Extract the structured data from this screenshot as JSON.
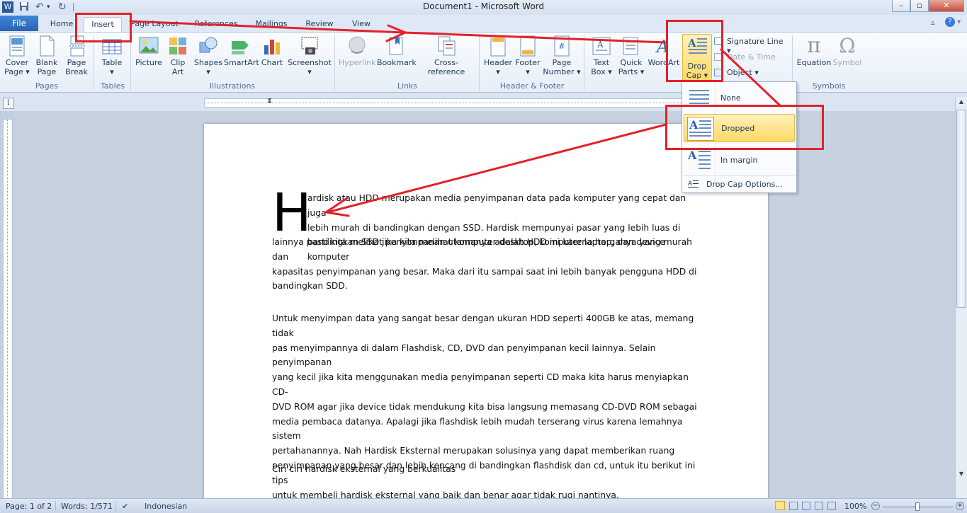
{
  "window": {
    "title": "Document1  -  Microsoft Word"
  },
  "tabs": {
    "file": "File",
    "home": "Home",
    "insert": "Insert",
    "page_layout": "Page Layout",
    "references": "References",
    "mailings": "Mailings",
    "review": "Review",
    "view": "View"
  },
  "ribbon": {
    "pages": {
      "cover_1": "Cover",
      "cover_2": "Page ▾",
      "blank_1": "Blank",
      "blank_2": "Page",
      "break_1": "Page",
      "break_2": "Break",
      "group": "Pages"
    },
    "tables": {
      "table_1": "Table",
      "table_2": "▾",
      "group": "Tables"
    },
    "illustrations": {
      "picture": "Picture",
      "clip_1": "Clip",
      "clip_2": "Art",
      "shapes_1": "Shapes",
      "shapes_2": "▾",
      "smartart": "SmartArt",
      "chart": "Chart",
      "screenshot_1": "Screenshot",
      "screenshot_2": "▾",
      "group": "Illustrations"
    },
    "links": {
      "hyperlink": "Hyperlink",
      "bookmark": "Bookmark",
      "crossref": "Cross-reference",
      "group": "Links"
    },
    "header_footer": {
      "header_1": "Header",
      "header_2": "▾",
      "footer_1": "Footer",
      "footer_2": "▾",
      "pagenum_1": "Page",
      "pagenum_2": "Number ▾",
      "group": "Header & Footer"
    },
    "text": {
      "textbox_1": "Text",
      "textbox_2": "Box ▾",
      "quick_1": "Quick",
      "quick_2": "Parts ▾",
      "wordart": "WordArt",
      "dropcap_1": "Drop",
      "dropcap_2": "Cap ▾",
      "signature": "Signature Line ▾",
      "datetime": "Date & Time",
      "object": "Object ▾"
    },
    "symbols": {
      "equation": "Equation",
      "symbol": "Symbol",
      "group": "Symbols"
    }
  },
  "dropdown": {
    "none": "None",
    "dropped": "Dropped",
    "in_margin": "In margin",
    "options": "Drop Cap Options..."
  },
  "document": {
    "dropcap": "H",
    "p1_lines": [
      "ardisk atau HDD merupakan media penyimpanan data pada komputer yang cepat dan juga",
      "lebih murah di bandingkan dengan SSD. Hardisk mempunyai pasar yang lebih luas di",
      "bandingkan SSD jika kita melihat komputer desktop, komputer laptop, dan device komputer"
    ],
    "p1_rest": [
      "lainnya pasti kita melihat penyimpanan utamanya adalah HDD ini karena harganya yang murah dan",
      "kapasitas penyimpanan yang besar. Maka dari itu sampai saat ini lebih banyak pengguna HDD di",
      "bandingkan SDD."
    ],
    "p2_lines": [
      "Untuk menyimpan data yang sangat besar dengan ukuran HDD seperti 400GB ke atas, memang tidak",
      "pas menyimpannya di dalam Flashdisk, CD, DVD dan penyimpanan kecil lainnya. Selain penyimpanan",
      "yang kecil jika kita menggunakan media penyimpanan seperti CD maka kita harus menyiapkan CD-",
      "DVD ROM agar jika device tidak mendukung kita bisa langsung memasang CD-DVD ROM sebagai",
      "media pembaca datanya. Apalagi jika flashdisk lebih mudah terserang virus karena lemahnya sistem",
      "pertahanannya. Nah Hardisk Eksternal merupakan solusinya yang dapat memberikan ruang",
      "penyimpanan yang besar dan lebih kencang di bandingkan flashdisk dan cd, untuk itu  berikut ini tips",
      "untuk membeli hardisk eksternal yang baik dan benar agar tidak rugi nantinya."
    ],
    "p3": "Ciri ciri hardisk eksternal yang berkualitas"
  },
  "status": {
    "page": "Page: 1 of 2",
    "words": "Words: 1/571",
    "language": "Indonesian",
    "zoom": "100%"
  },
  "colors": {
    "annotation_red": "#e3212a",
    "accent_blue": "#2a62b4",
    "highlight": "#ffd966"
  }
}
